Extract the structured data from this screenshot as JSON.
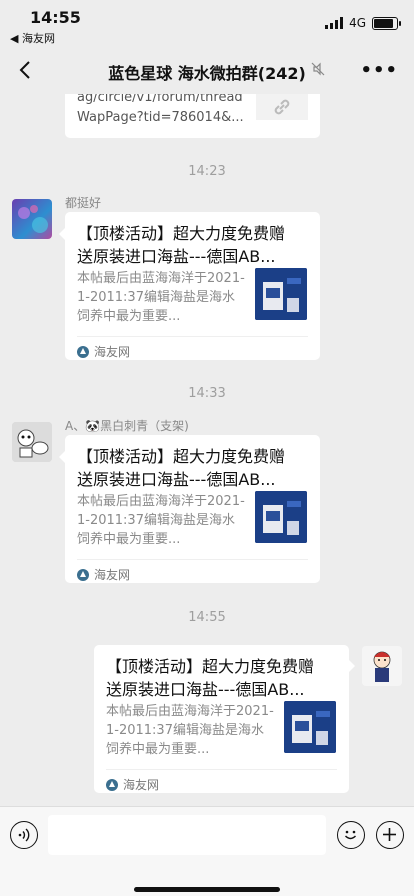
{
  "status": {
    "time": "14:55",
    "back_app": "◀ 海友网",
    "network": "4G",
    "battery_level": 0.85
  },
  "nav": {
    "title": "蓝色星球 海水微拍群(242)",
    "more_icon": "more-icon",
    "mute_icon": "mute-icon"
  },
  "top_message": {
    "url_text": "ag/circle/v1/forum/thread\nWapPage?tid=786014&..."
  },
  "timestamps": [
    "14:23",
    "14:33",
    "14:55"
  ],
  "messages": [
    {
      "sender": "都挺好",
      "title": "【顶楼活动】超大力度免费赠送原装进口海盐---德国AB...",
      "desc": "本帖最后由蓝海海洋于2021-1-2011:37编辑海盐是海水饲养中最为重要...",
      "source": "海友网"
    },
    {
      "sender": "A、🐼黑白刺青（支架)",
      "title": "【顶楼活动】超大力度免费赠送原装进口海盐---德国AB...",
      "desc": "本帖最后由蓝海海洋于2021-1-2011:37编辑海盐是海水饲养中最为重要...",
      "source": "海友网"
    },
    {
      "sender": "",
      "title": "【顶楼活动】超大力度免费赠送原装进口海盐---德国AB...",
      "desc": "本帖最后由蓝海海洋于2021-1-2011:37编辑海盐是海水饲养中最为重要...",
      "source": "海友网"
    }
  ],
  "input_bar": {
    "voice_icon": "voice-icon",
    "emoji_icon": "emoji-icon",
    "plus_icon": "plus-icon",
    "input_value": ""
  }
}
